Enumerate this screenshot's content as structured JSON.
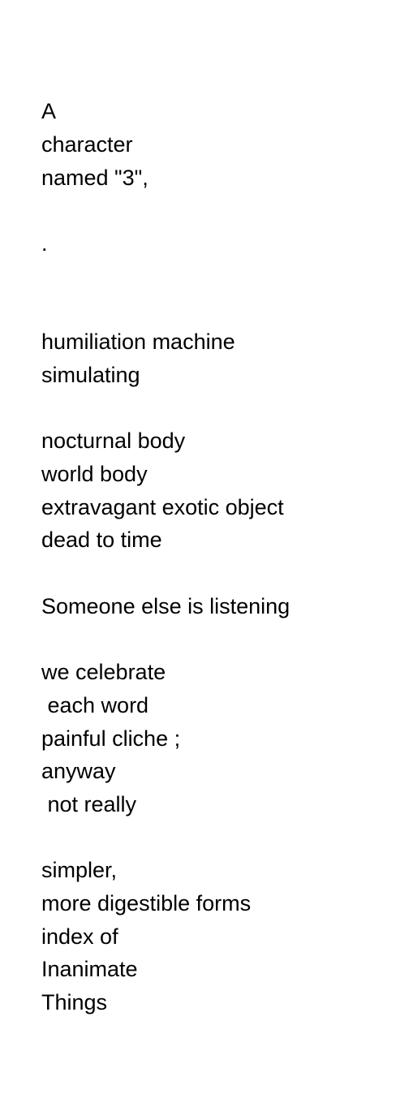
{
  "poem": {
    "stanza1": [
      "A",
      "character",
      "named \"3\","
    ],
    "stanza2": [
      "."
    ],
    "stanza3": [
      "humiliation machine",
      "simulating"
    ],
    "stanza4": [
      "nocturnal body",
      "world body",
      "extravagant exotic object",
      "dead to time"
    ],
    "stanza5": [
      "Someone else is listening"
    ],
    "stanza6": [
      "we celebrate",
      " each word",
      "painful cliche ;",
      "anyway",
      " not really"
    ],
    "stanza7": [
      "simpler,",
      "more digestible forms",
      "index of",
      "Inanimate",
      "Things"
    ]
  }
}
